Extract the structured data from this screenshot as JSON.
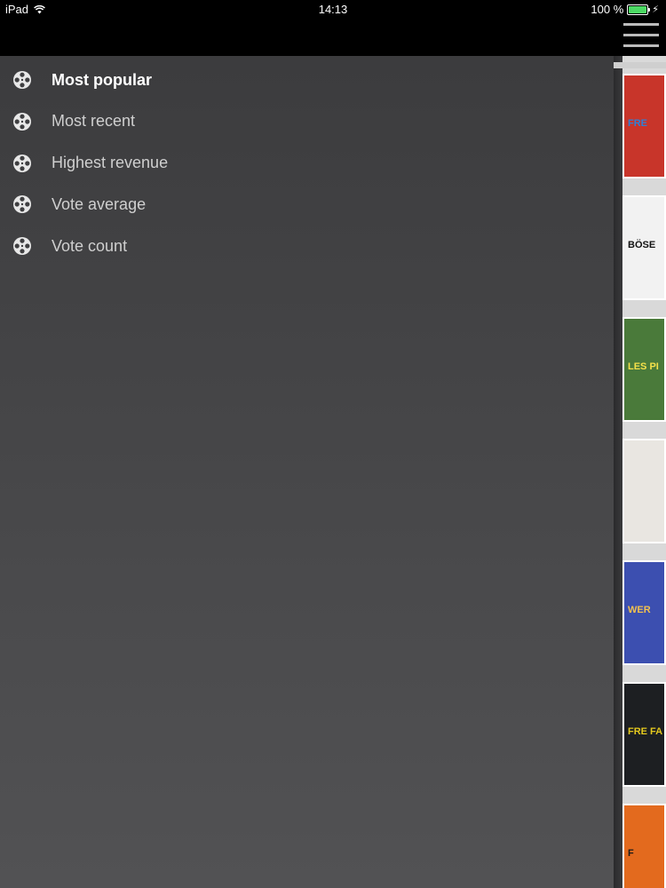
{
  "status_bar": {
    "device": "iPad",
    "time": "14:13",
    "battery": "100 %"
  },
  "menu": {
    "items": [
      {
        "label": "Most popular",
        "icon": "film-reel-icon",
        "active": true
      },
      {
        "label": "Most recent",
        "icon": "film-reel-icon",
        "active": false
      },
      {
        "label": "Highest revenue",
        "icon": "film-reel-icon",
        "active": false
      },
      {
        "label": "Vote average",
        "icon": "film-reel-icon",
        "active": false
      },
      {
        "label": "Vote count",
        "icon": "film-reel-icon",
        "active": false
      }
    ]
  },
  "posters": [
    {
      "text": "FRE",
      "bg": "#c8352a",
      "fg": "#2f7fd6"
    },
    {
      "text": "BÖSE",
      "bg": "#f2f2f2",
      "fg": "#111111"
    },
    {
      "text": "LES PI",
      "bg": "#4a7a3a",
      "fg": "#f5e14a"
    },
    {
      "text": "",
      "bg": "#e9e6e1",
      "fg": "#222222"
    },
    {
      "text": "WER",
      "bg": "#3c4fb0",
      "fg": "#f2c14e"
    },
    {
      "text": "FRE FA",
      "bg": "#1d1f22",
      "fg": "#e5c91e"
    },
    {
      "text": "F",
      "bg": "#e36a1e",
      "fg": "#1a1a1a"
    }
  ],
  "colors": {
    "menu_text": "#cfcfcf",
    "menu_text_active": "#ffffff",
    "battery": "#4cd964"
  }
}
